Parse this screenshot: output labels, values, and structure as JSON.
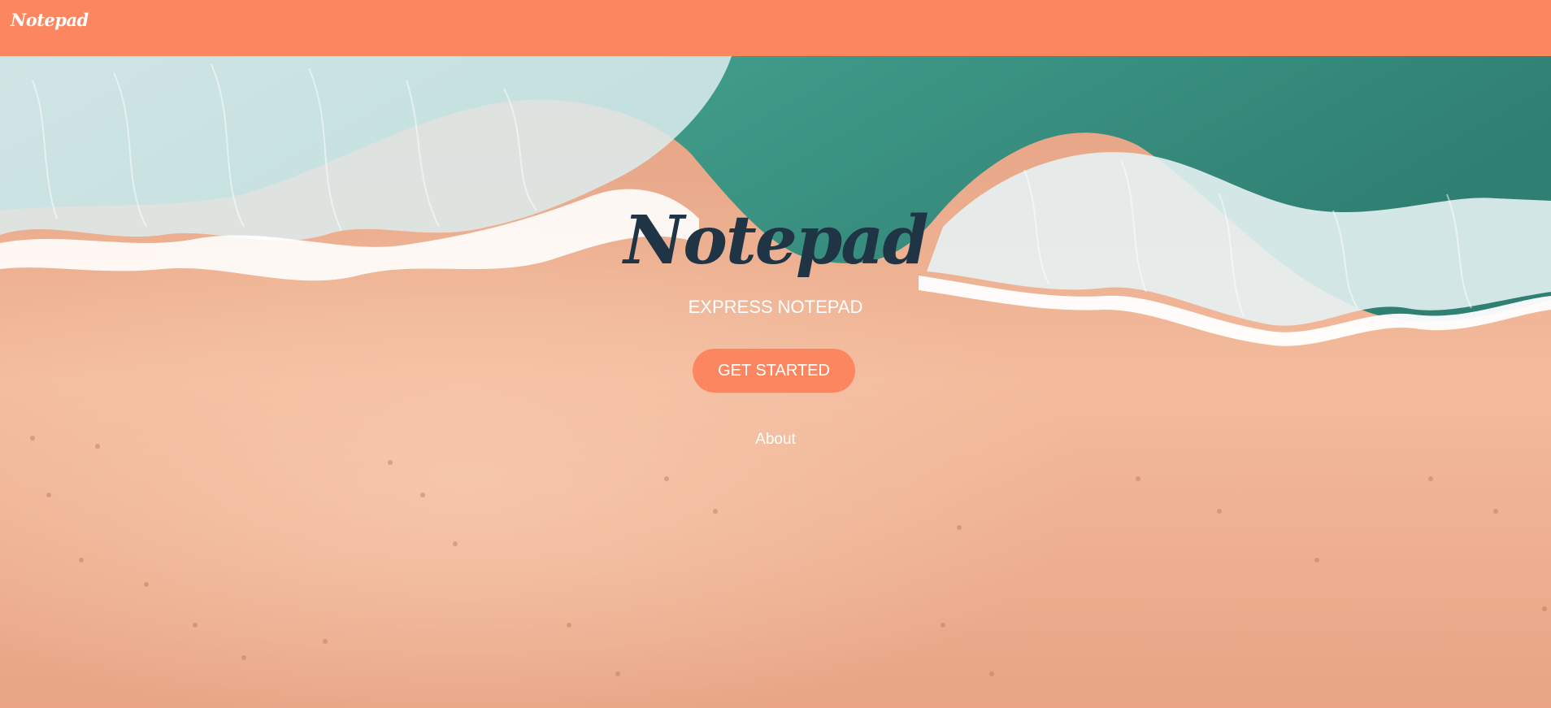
{
  "navbar": {
    "brand": "Notepad",
    "background_color": "#fb8660"
  },
  "hero": {
    "title": "Notepad",
    "subtitle": "EXPRESS NOTEPAD",
    "cta_label": "GET STARTED",
    "about_label": "About",
    "title_color": "#1f3444",
    "button_color": "#fb8660",
    "background_image": "aerial-beach-waves"
  }
}
